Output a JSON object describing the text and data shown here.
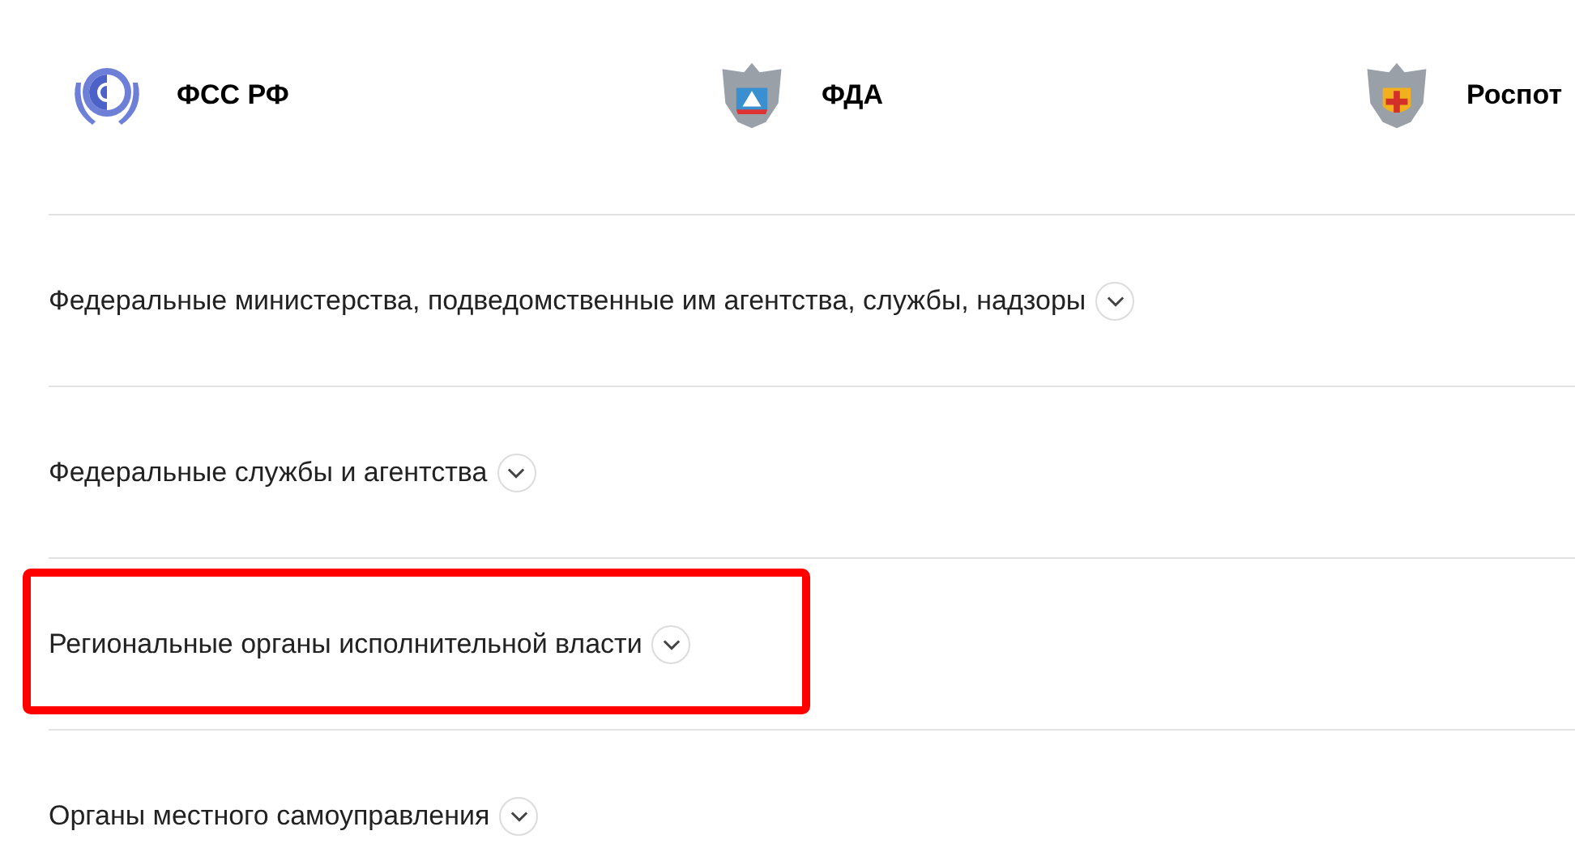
{
  "agencies": [
    {
      "kind": "globe",
      "name": "ФСС РФ"
    },
    {
      "kind": "eagle-blue",
      "name": "ФДА"
    },
    {
      "kind": "eagle-red",
      "name": "Роспот"
    }
  ],
  "sections": [
    {
      "title": "Федеральные министерства, подведомственные им агентства, службы, надзоры",
      "expanded": false,
      "highlighted": false
    },
    {
      "title": "Федеральные службы и агентства",
      "expanded": false,
      "highlighted": false
    },
    {
      "title": "Региональные органы исполнительной власти",
      "expanded": false,
      "highlighted": true
    },
    {
      "title": "Органы местного самоуправления",
      "expanded": false,
      "highlighted": false
    }
  ]
}
